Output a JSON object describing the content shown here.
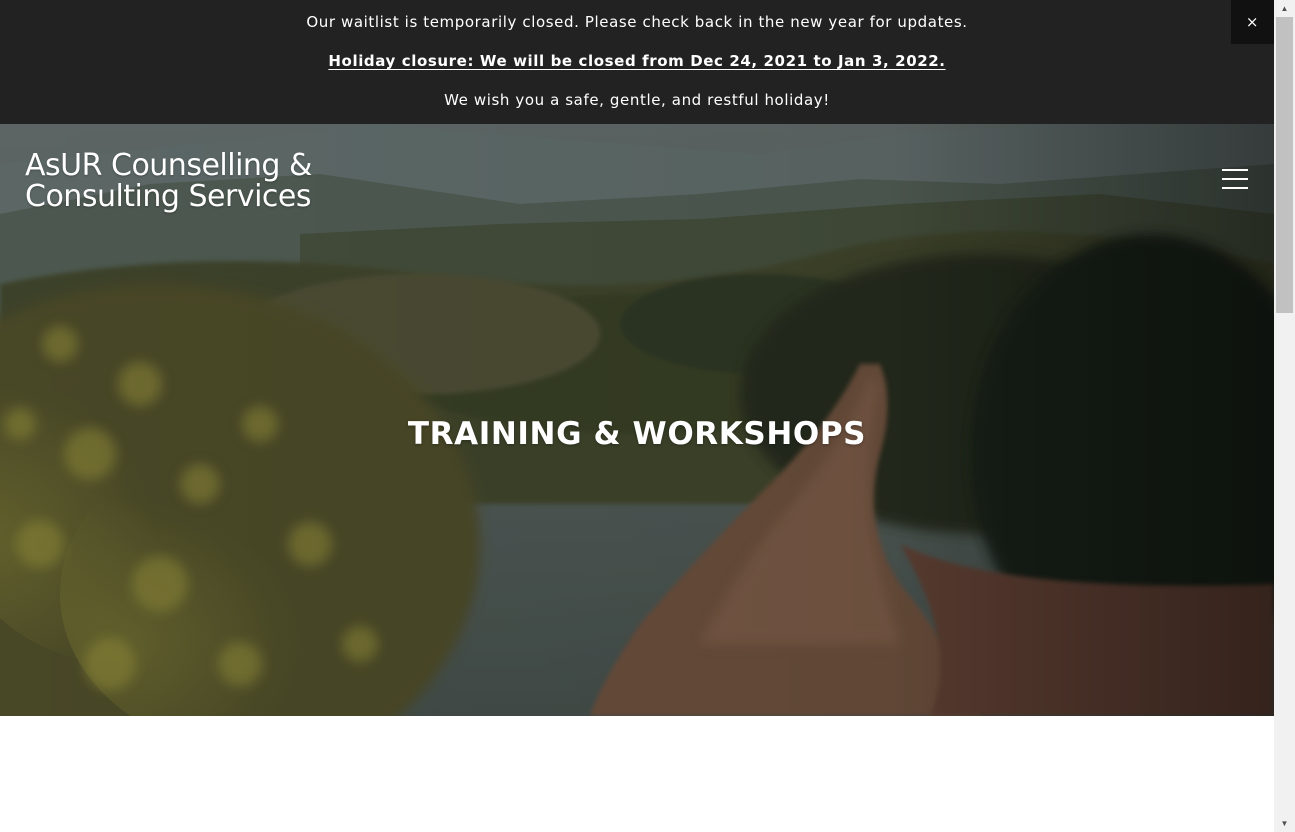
{
  "announcement": {
    "line1": "Our waitlist is temporarily closed. Please check back in the new year for updates.",
    "line2": "Holiday closure: We will be closed from Dec 24, 2021 to Jan 3, 2022. ",
    "line3": "We wish you a safe, gentle, and restful holiday!",
    "close_label": "×"
  },
  "header": {
    "logo_line1": "AsUR Counselling &",
    "logo_line2": "Consulting Services",
    "menu_icon": "hamburger-menu-icon"
  },
  "hero": {
    "title": "TRAINING & WORKSHOPS",
    "image": "nature-path-landscape"
  },
  "scrollbar": {
    "up_glyph": "▲",
    "down_glyph": "▼"
  },
  "colors": {
    "announcement_bg": "#222222",
    "text_light": "#ffffff",
    "page_bg": "#ffffff"
  }
}
